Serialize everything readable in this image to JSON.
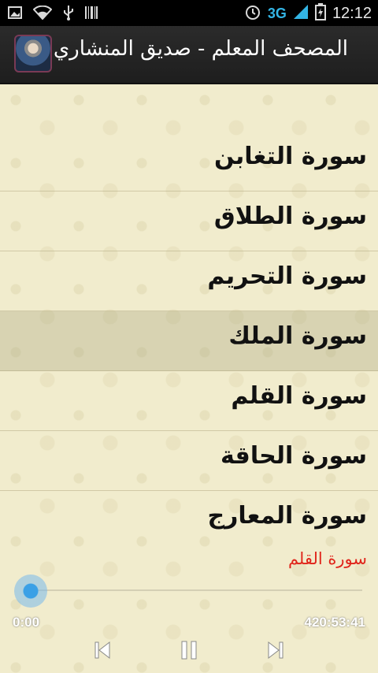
{
  "status_bar": {
    "time": "12:12",
    "network": "3G",
    "network_small": "3G"
  },
  "action_bar": {
    "title": "المصحف المعلم - صديق المنشاري"
  },
  "surah_list": [
    {
      "label": "سورة التغابن"
    },
    {
      "label": "سورة الطلاق"
    },
    {
      "label": "سورة التحريم"
    },
    {
      "label": "سورة الملك",
      "selected": true
    },
    {
      "label": "سورة القلم"
    },
    {
      "label": "سورة الحاقة"
    },
    {
      "label": "سورة المعارج"
    }
  ],
  "player": {
    "now_playing": "سورة القلم",
    "current_time": "0:00",
    "duration": "420:53:41",
    "progress": 0
  },
  "colors": {
    "accent": "#33b5e5",
    "now_playing_text": "#e0251b",
    "background": "#f1eccd"
  },
  "icons": {
    "prev": "skip-previous-icon",
    "pause": "pause-icon",
    "next": "skip-next-icon"
  }
}
